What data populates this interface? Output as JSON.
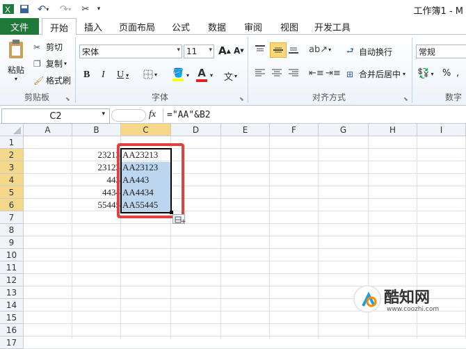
{
  "window": {
    "title": "工作簿1 - M"
  },
  "tabs": {
    "file": "文件",
    "items": [
      "开始",
      "插入",
      "页面布局",
      "公式",
      "数据",
      "审阅",
      "视图",
      "开发工具"
    ]
  },
  "ribbon": {
    "clipboard": {
      "paste": "粘贴",
      "cut": "剪切",
      "copy": "复制",
      "format_painter": "格式刷",
      "label": "剪贴板"
    },
    "font": {
      "name": "宋体",
      "size": "11",
      "bold": "B",
      "italic": "I",
      "underline": "U",
      "label": "字体",
      "grow": "A",
      "shrink": "A",
      "font_color": "A"
    },
    "alignment": {
      "wrap": "自动换行",
      "merge": "合并后居中",
      "label": "对齐方式"
    },
    "number": {
      "format": "常规",
      "percent": "%",
      "label": "数字"
    }
  },
  "formula_bar": {
    "name_box": "C2",
    "fx": "fx",
    "formula": "=\"AA\"&B2"
  },
  "columns": [
    "A",
    "B",
    "C",
    "D",
    "E",
    "F",
    "G",
    "H",
    "I"
  ],
  "rows": [
    "1",
    "2",
    "3",
    "4",
    "5",
    "6",
    "7",
    "8",
    "9",
    "10",
    "11",
    "12",
    "13",
    "14",
    "15",
    "16",
    "17"
  ],
  "cells": {
    "B": [
      "",
      "23213",
      "23123",
      "443",
      "4434",
      "55445"
    ],
    "C": [
      "",
      "AA23213",
      "AA23123",
      "AA443",
      "AA4434",
      "AA55445"
    ]
  },
  "watermark": {
    "name": "酷知网",
    "url": "www.coozhi.com"
  },
  "colors": {
    "file_tab": "#1f7a3a",
    "selection": "#bcd6f0",
    "highlight_box": "#e0403f",
    "header_selected": "#f5d88a"
  }
}
